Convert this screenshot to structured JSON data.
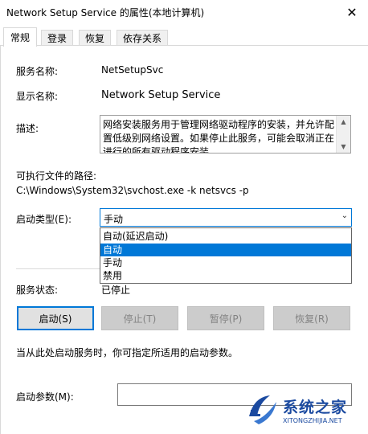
{
  "window": {
    "title": "Network Setup Service 的属性(本地计算机)",
    "close_glyph": "✕"
  },
  "tabs": [
    {
      "label": "常规"
    },
    {
      "label": "登录"
    },
    {
      "label": "恢复"
    },
    {
      "label": "依存关系"
    }
  ],
  "general": {
    "service_name_label": "服务名称:",
    "service_name": "NetSetupSvc",
    "display_name_label": "显示名称:",
    "display_name": "Network Setup Service",
    "description_label": "描述:",
    "description": "网络安装服务用于管理网络驱动程序的安装，并允许配置低级别网络设置。如果停止此服务，可能会取消正在进行的所有驱动程序安装",
    "exe_path_label": "可执行文件的路径:",
    "exe_path": "C:\\Windows\\System32\\svchost.exe -k netsvcs -p",
    "startup_type_label": "启动类型(E):",
    "startup_type_value": "手动",
    "startup_options": [
      "自动(延迟启动)",
      "自动",
      "手动",
      "禁用"
    ],
    "status_label": "服务状态:",
    "status_value": "已停止",
    "buttons": {
      "start": "启动(S)",
      "stop": "停止(T)",
      "pause": "暂停(P)",
      "resume": "恢复(R)"
    },
    "hint": "当从此处启动服务时，你可指定所适用的启动参数。",
    "start_params_label": "启动参数(M):",
    "start_params_value": ""
  },
  "watermark": {
    "name": "系统之家",
    "url": "XITONGZHIJIA.NET"
  },
  "colors": {
    "accent": "#0078d7",
    "watermark": "#1b4aa0"
  }
}
